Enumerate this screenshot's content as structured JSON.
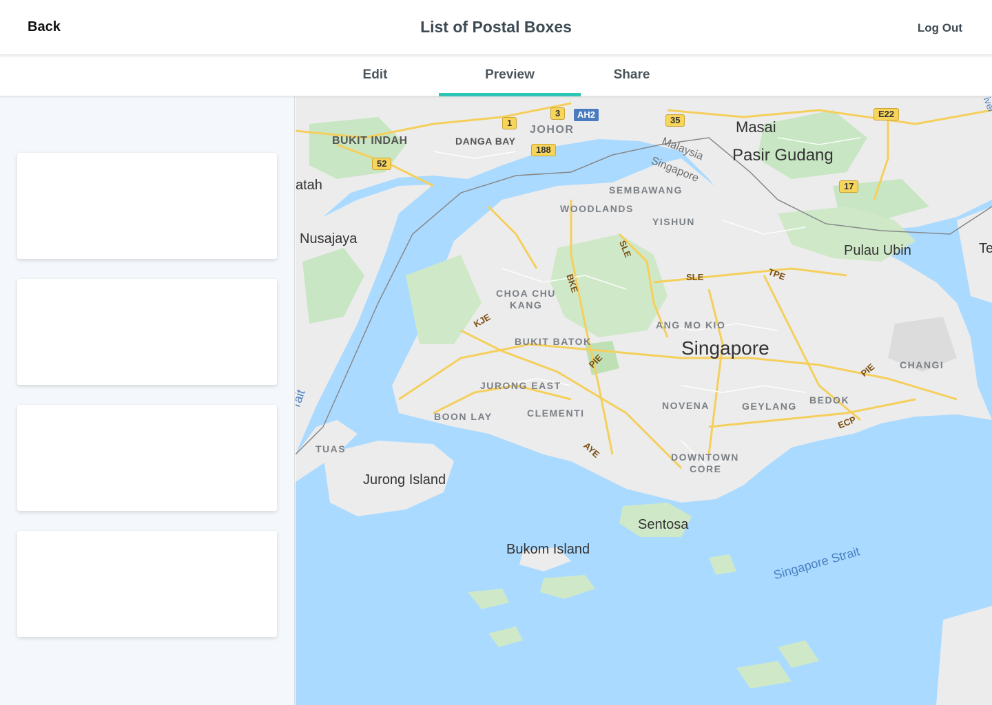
{
  "header": {
    "back_label": "Back",
    "title": "List of Postal Boxes",
    "logout_label": "Log Out"
  },
  "tabs": [
    {
      "label": "Edit",
      "active": false
    },
    {
      "label": "Preview",
      "active": true
    },
    {
      "label": "Share",
      "active": false
    }
  ],
  "accent_color": "#2ec4b6",
  "sidebar": {
    "cards": [
      {},
      {},
      {},
      {}
    ]
  },
  "map": {
    "labels": {
      "city": "Singapore",
      "masai": "Masai",
      "pasir_gudang": "Pasir Gudang",
      "bukit_indah": "BUKIT INDAH",
      "danga_bay": "DANGA BAY",
      "johor": "JOHOR",
      "nusajaya": "Nusajaya",
      "atah": "atah",
      "pulau_ubin": "Pulau Ubin",
      "tek": "Tek",
      "sembawang": "SEMBAWANG",
      "woodlands": "WOODLANDS",
      "yishun": "YISHUN",
      "choa_chu": "CHOA CHU",
      "kang": "KANG",
      "ang_mo_kio": "ANG MO KIO",
      "bukit_batok": "BUKIT BATOK",
      "jurong_east": "JURONG EAST",
      "changi": "CHANGI",
      "boon_lay": "BOON LAY",
      "clementi": "CLEMENTI",
      "novena": "NOVENA",
      "geylang": "GEYLANG",
      "bedok": "BEDOK",
      "tuas": "TUAS",
      "downtown": "DOWNTOWN",
      "core": "CORE",
      "jurong_island": "Jurong Island",
      "sentosa": "Sentosa",
      "bukom_island": "Bukom Island",
      "singapore_strait": "Singapore Strait",
      "strait_left": "rait",
      "river": "iver",
      "malaysia": "Malaysia",
      "singapore_border": "Singapore"
    },
    "roads": {
      "bke": "BKE",
      "sle_v": "SLE",
      "sle_h": "SLE",
      "tpe": "TPE",
      "kje": "KJE",
      "pie_w": "PIE",
      "pie_e": "PIE",
      "aye": "AYE",
      "ecp": "ECP"
    },
    "shields": {
      "r1": "1",
      "r3": "3",
      "ah2": "AH2",
      "r35": "35",
      "e22": "E22",
      "r188": "188",
      "r52": "52",
      "r17": "17"
    }
  }
}
